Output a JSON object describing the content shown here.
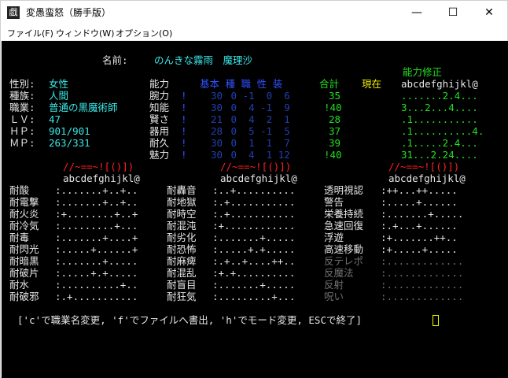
{
  "window": {
    "app_icon": "戯",
    "title": "変愚蛮怒（勝手版）",
    "minimize_icon": "—",
    "maximize_icon": "☐",
    "close_icon": "✕",
    "menu": [
      "ファイル(F)",
      "ウィンドウ(W)",
      "オプション(O)"
    ]
  },
  "character": {
    "name_label": "名前:",
    "name": "のんきな霧雨　魔理沙",
    "mods_header": "能力修正",
    "info": [
      {
        "label": "性別:",
        "value": "女性"
      },
      {
        "label": "種族:",
        "value": "人間"
      },
      {
        "label": "職業:",
        "value": "普通の黒魔術師"
      },
      {
        "label": "ＬＶ:",
        "value": "47"
      },
      {
        "label": "ＨＰ:",
        "value": "901/901"
      },
      {
        "label": "ＭＰ:",
        "value": "263/331"
      }
    ]
  },
  "stats": {
    "header_ability": "能力",
    "header_cols": "基本 種 職 性 装",
    "header_total": "合計",
    "header_current": "現在",
    "mods_letters": "abcdefghijkl@",
    "rows": [
      {
        "name": "腕力",
        "base": "30",
        "vals": " 0 -1  0  6",
        "total": "35",
        "mods": ".......2.4..."
      },
      {
        "name": "知能",
        "base": "30",
        "vals": " 0  4 -1  9",
        "total": "!40",
        "mods": "3...2...4...."
      },
      {
        "name": "賢さ",
        "base": "21",
        "vals": " 0  4  2  1",
        "total": "28",
        "mods": ".1..........."
      },
      {
        "name": "器用",
        "base": "28",
        "vals": " 0  5 -1  5",
        "total": "37",
        "mods": ".1..........4."
      },
      {
        "name": "耐久",
        "base": "30",
        "vals": " 0  1  1  7",
        "total": "39",
        "mods": ".1.....2.4..."
      },
      {
        "name": "魅力",
        "base": "30",
        "vals": " 0  4  1 12",
        "total": "!40",
        "mods": "31...2.24...."
      }
    ]
  },
  "resist": {
    "equip_symbols": "//~==~![()])",
    "letters": "abcdefghijkl@",
    "col1": [
      {
        "label": "耐酸",
        "value": ":.......+..+.."
      },
      {
        "label": "耐電撃",
        "value": ":.......+..+.."
      },
      {
        "label": "耐火炎",
        "value": ":+........+..+"
      },
      {
        "label": "耐冷気",
        "value": ":.........+..."
      },
      {
        "label": "耐毒",
        "value": ":.......+....+"
      },
      {
        "label": "耐閃光",
        "value": ":.....+......+"
      },
      {
        "label": "耐暗黒",
        "value": ":.......+....."
      },
      {
        "label": "耐破片",
        "value": ":.....+.+....."
      },
      {
        "label": "耐水",
        "value": ":..........+.."
      },
      {
        "label": "耐破邪",
        "value": ":.+..........."
      }
    ],
    "col2": [
      {
        "label": "耐轟音",
        "value": ":..+.........."
      },
      {
        "label": "耐地獄",
        "value": ":.+..........."
      },
      {
        "label": "耐時空",
        "value": ":.+..........."
      },
      {
        "label": "耐混沌",
        "value": ":+............"
      },
      {
        "label": "耐劣化",
        "value": ":.......+....."
      },
      {
        "label": "耐恐怖",
        "value": ":.....+.+....."
      },
      {
        "label": "耐麻痺",
        "value": ":.+..+....++.."
      },
      {
        "label": "耐混乱",
        "value": ":+.+.........."
      },
      {
        "label": "耐盲目",
        "value": ":.......+....."
      },
      {
        "label": "耐狂気",
        "value": ":.........+..."
      }
    ],
    "col3": [
      {
        "label": "透明視認",
        "value": ":++...++....."
      },
      {
        "label": "警告",
        "value": ":.....+......"
      },
      {
        "label": "栄養持続",
        "value": ":.......+....."
      },
      {
        "label": "急速回復",
        "value": ":.+...+......"
      },
      {
        "label": "浮遊",
        "value": ":+.......++.."
      },
      {
        "label": "高速移動",
        "value": ":+.....+....."
      },
      {
        "label": "反テレポ",
        "value": ":............."
      },
      {
        "label": "反魔法",
        "value": ":............."
      },
      {
        "label": "反射",
        "value": ":............."
      },
      {
        "label": "呪い",
        "value": ":............."
      }
    ]
  },
  "footer": "['c'で職業名変更, 'f'でファイルへ書出, 'h'でモード変更, ESCで終了]"
}
